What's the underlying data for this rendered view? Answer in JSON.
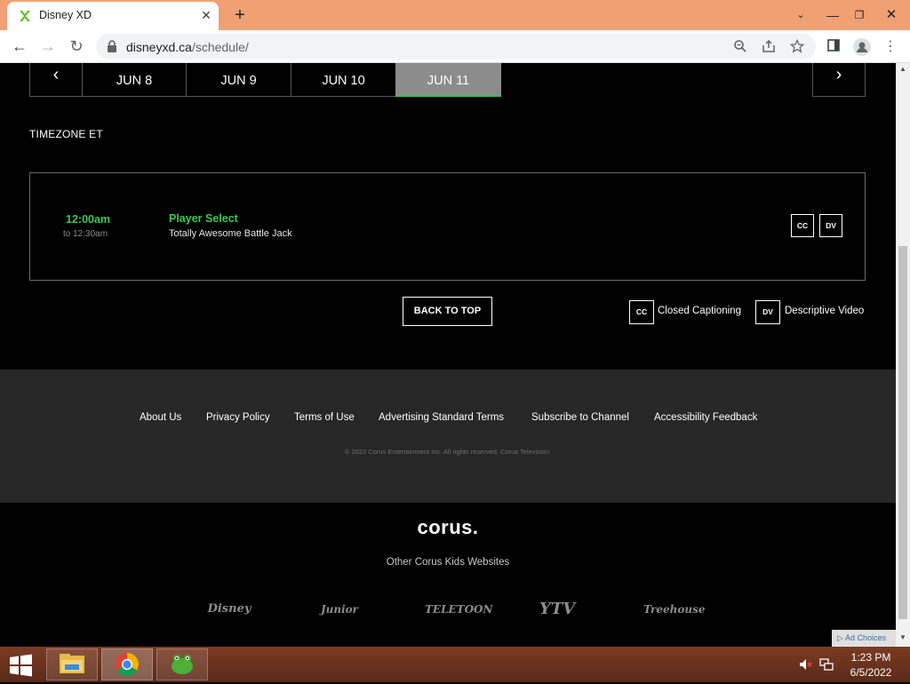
{
  "browser": {
    "tab_title": "Disney XD",
    "tab_close": "✕",
    "new_tab": "+",
    "url_host": "disneyxd.ca",
    "url_path": "/schedule/",
    "window": {
      "dropdown": "⌄",
      "minimize": "—",
      "maximize": "❐",
      "close": "✕"
    }
  },
  "schedule": {
    "dates": [
      "JUN 8",
      "JUN 9",
      "JUN 10",
      "JUN 11"
    ],
    "selected_date": "JUN 11",
    "timezone_label": "TIMEZONE ET",
    "items": [
      {
        "start": "12:00am",
        "end": "to 12:30am",
        "title": "Player Select",
        "episode": "Totally Awesome Battle Jack",
        "badges": [
          "CC",
          "DV"
        ]
      }
    ],
    "back_to_top": "BACK TO TOP",
    "legend": [
      {
        "badge": "CC",
        "label": "Closed Captioning"
      },
      {
        "badge": "DV",
        "label": "Descriptive Video"
      }
    ]
  },
  "footer": {
    "links": [
      "About Us",
      "Privacy Policy",
      "Terms of Use",
      "Advertising Standard Terms",
      "Subscribe to Channel",
      "Accessibility Feedback"
    ],
    "copyright": "© 2022 Corus Entertainment Inc. All rights reserved. Corus Television."
  },
  "corus": {
    "logo": "corus.",
    "other_sites": "Other Corus Kids Websites",
    "kid_sites": [
      "Disney",
      "Junior",
      "TELETOON",
      "YTV",
      "Treehouse"
    ]
  },
  "ad_choices": "Ad Choices",
  "taskbar": {
    "time": "1:23 PM",
    "date": "6/5/2022"
  },
  "colors": {
    "accent_green": "#3cc957",
    "titlebar": "#f0a073",
    "footer_bg": "#272727",
    "selected_date_bg": "#8c8c8c"
  }
}
